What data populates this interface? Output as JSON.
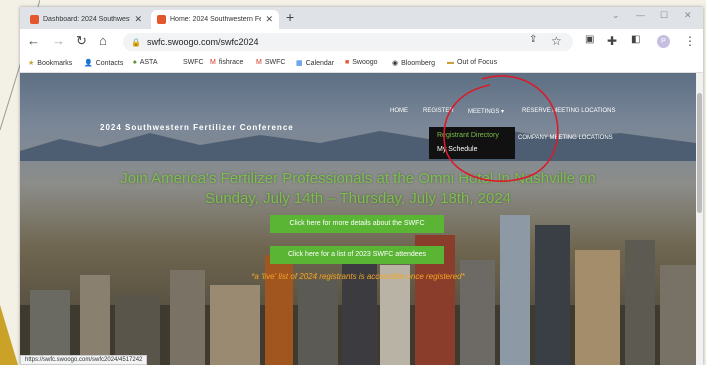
{
  "tabs": [
    {
      "title": "Dashboard: 2024 Southwestern F..."
    },
    {
      "title": "Home: 2024 Southwestern Ferti..."
    }
  ],
  "url": "swfc.swoogo.com/swfc2024",
  "bookmarks": [
    "Bookmarks",
    "Contacts",
    "ASTA",
    "SWFC",
    "fishrace",
    "SWFC",
    "Calendar",
    "Swoogo",
    "Bloomberg",
    "Out of Focus"
  ],
  "site": {
    "title": "2024 Southwestern Fertilizer Conference",
    "nav": {
      "home": "HOME",
      "register": "REGISTER",
      "meetings": "MEETINGS ▾",
      "reserve": "RESERVE MEETING LOCATIONS",
      "company": "COMPANY MEETING LOCATIONS"
    },
    "dropdown": [
      "Registrant Directory",
      "My Schedule"
    ],
    "headline1": "Join America's Fertilizer Professionals at the Omni Hotel In Nashville on",
    "headline2": "Sunday, July 14th – Thursday, July 18th, 2024",
    "btn1": "Click here for more details about the SWFC",
    "btn2": "Click here for a list of 2023 SWFC attendees",
    "note": "*a 'live' list of 2024 registrants is accessible once registered*"
  },
  "status_url": "https://swfc.swoogo.com/swfc2024/4517242",
  "colors": {
    "accent_green": "#5bb535",
    "headline_green": "#7cc04b",
    "note_orange": "#f5a623",
    "annotation_red": "#d91c2a"
  }
}
